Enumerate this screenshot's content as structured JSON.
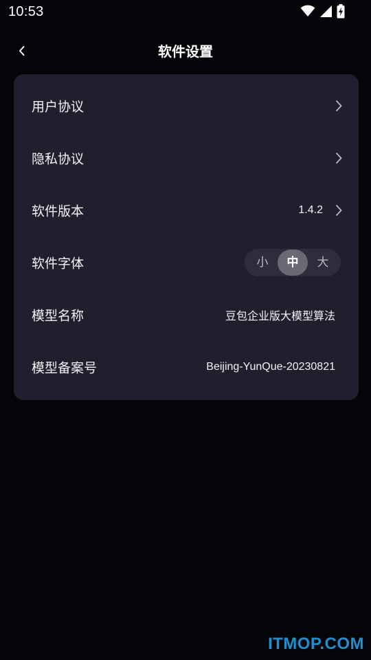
{
  "status_bar": {
    "time": "10:53",
    "icons": [
      "wifi-icon",
      "cellular-signal-icon",
      "battery-charging-icon"
    ]
  },
  "header": {
    "back_icon": "chevron-left-icon",
    "title": "软件设置"
  },
  "settings": {
    "user_agreement": {
      "label": "用户协议"
    },
    "privacy_agreement": {
      "label": "隐私协议"
    },
    "software_version": {
      "label": "软件版本",
      "value": "1.4.2"
    },
    "software_font": {
      "label": "软件字体",
      "options": [
        "小",
        "中",
        "大"
      ],
      "selected": "中"
    },
    "model_name": {
      "label": "模型名称",
      "value": "豆包企业版大模型算法"
    },
    "model_filing_number": {
      "label": "模型备案号",
      "value": "Beijing-YunQue-20230821"
    }
  },
  "watermark": "ITMOP.COM",
  "colors": {
    "background": "#050409",
    "card": "#211f2e",
    "toggle_track": "#2f2d3c",
    "toggle_selected": "#6a6874",
    "watermark": "#1f8fce"
  }
}
